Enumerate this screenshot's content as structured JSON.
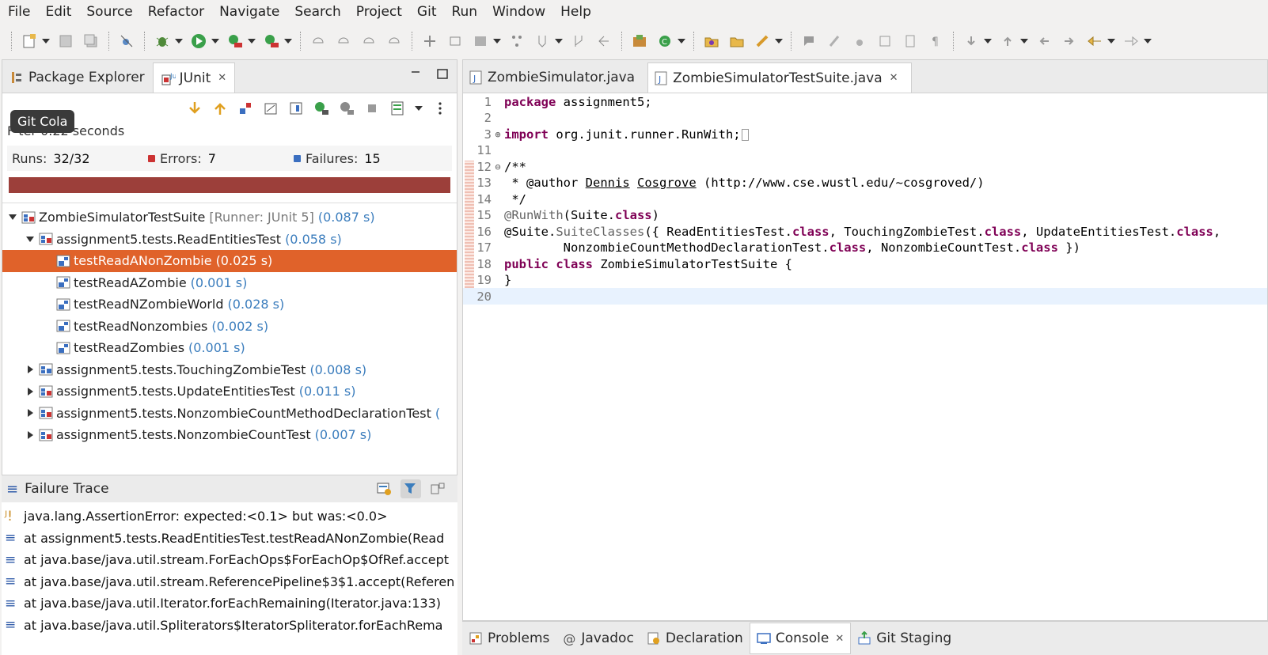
{
  "menu": [
    "File",
    "Edit",
    "Source",
    "Refactor",
    "Navigate",
    "Search",
    "Project",
    "Git",
    "Run",
    "Window",
    "Help"
  ],
  "left_tabs": {
    "package_explorer": "Package Explorer",
    "junit": "JUnit",
    "close_glyph": "✕"
  },
  "junit": {
    "finished_text": "F ter 0.22 seconds",
    "tooltip": "Git Cola",
    "runs_label": "Runs:",
    "runs_value": "32/32",
    "errors_label": "Errors:",
    "errors_value": "7",
    "failures_label": "Failures:",
    "failures_value": "15",
    "progress_color": "#9c3f3a",
    "progress_fraction": 1.0
  },
  "tree": [
    {
      "name": "ZombieSimulatorTestSuite",
      "runner": "[Runner: JUnit 5]",
      "time": "(0.087 s)"
    },
    {
      "name": "assignment5.tests.ReadEntitiesTest",
      "time": "(0.058 s)"
    },
    {
      "name": "testReadANonZombie",
      "time": "(0.025 s)"
    },
    {
      "name": "testReadAZombie",
      "time": "(0.001 s)"
    },
    {
      "name": "testReadNZombieWorld",
      "time": "(0.028 s)"
    },
    {
      "name": "testReadNonzombies",
      "time": "(0.002 s)"
    },
    {
      "name": "testReadZombies",
      "time": "(0.001 s)"
    },
    {
      "name": "assignment5.tests.TouchingZombieTest",
      "time": "(0.008 s)"
    },
    {
      "name": "assignment5.tests.UpdateEntitiesTest",
      "time": "(0.011 s)"
    },
    {
      "name": "assignment5.tests.NonzombieCountMethodDeclarationTest",
      "time": "("
    },
    {
      "name": "assignment5.tests.NonzombieCountTest",
      "time": "(0.007 s)"
    }
  ],
  "trace": {
    "title": "Failure Trace",
    "lines": [
      "java.lang.AssertionError: expected:<0.1> but was:<0.0>",
      "at assignment5.tests.ReadEntitiesTest.testReadANonZombie(Read",
      "at java.base/java.util.stream.ForEachOps$ForEachOp$OfRef.accept",
      "at java.base/java.util.stream.ReferencePipeline$3$1.accept(Referen",
      "at java.base/java.util.Iterator.forEachRemaining(Iterator.java:133)",
      "at java.base/java.util.Spliterators$IteratorSpliterator.forEachRema"
    ]
  },
  "editor_tabs": {
    "tab1": "ZombieSimulator.java",
    "tab2": "ZombieSimulatorTestSuite.java",
    "close_glyph": "✕"
  },
  "code": {
    "line_numbers": [
      "1",
      "2",
      "3",
      "11",
      "12",
      "13",
      "14",
      "15",
      "16",
      "17",
      "18",
      "19",
      "20"
    ],
    "l1_kw": "package",
    "l1_rest": " assignment5;",
    "l3_kw": "import",
    "l3_rest": " org.junit.runner.RunWith;",
    "l12": "/**",
    "l13_a": " * @author ",
    "l13_name1": "Dennis",
    "l13_sp": " ",
    "l13_name2": "Cosgrove",
    "l13_url": " (http://www.cse.wustl.edu/~cosgroved/)",
    "l14": " */",
    "l15_ann": "@RunWith",
    "l15_a": "(Suite.",
    "l15_kw": "class",
    "l15_b": ")",
    "l16_a": "@Suite.",
    "l16_ann": "SuiteClasses",
    "l16_b": "({ ReadEntitiesTest.",
    "l16_kw1": "class",
    "l16_c": ", TouchingZombieTest.",
    "l16_kw2": "class",
    "l16_d": ", UpdateEntitiesTest.",
    "l16_kw3": "class",
    "l16_e": ",",
    "l17_a": "        NonzombieCountMethodDeclarationTest.",
    "l17_kw1": "class",
    "l17_b": ", NonzombieCountTest.",
    "l17_kw2": "class",
    "l17_c": " })",
    "l18_kw1": "public",
    "l18_sp": " ",
    "l18_kw2": "class",
    "l18_rest": " ZombieSimulatorTestSuite {",
    "l19": "}"
  },
  "bottom_tabs": {
    "problems": "Problems",
    "javadoc": "Javadoc",
    "declaration": "Declaration",
    "console": "Console",
    "git_staging": "Git Staging",
    "close_glyph": "✕"
  }
}
